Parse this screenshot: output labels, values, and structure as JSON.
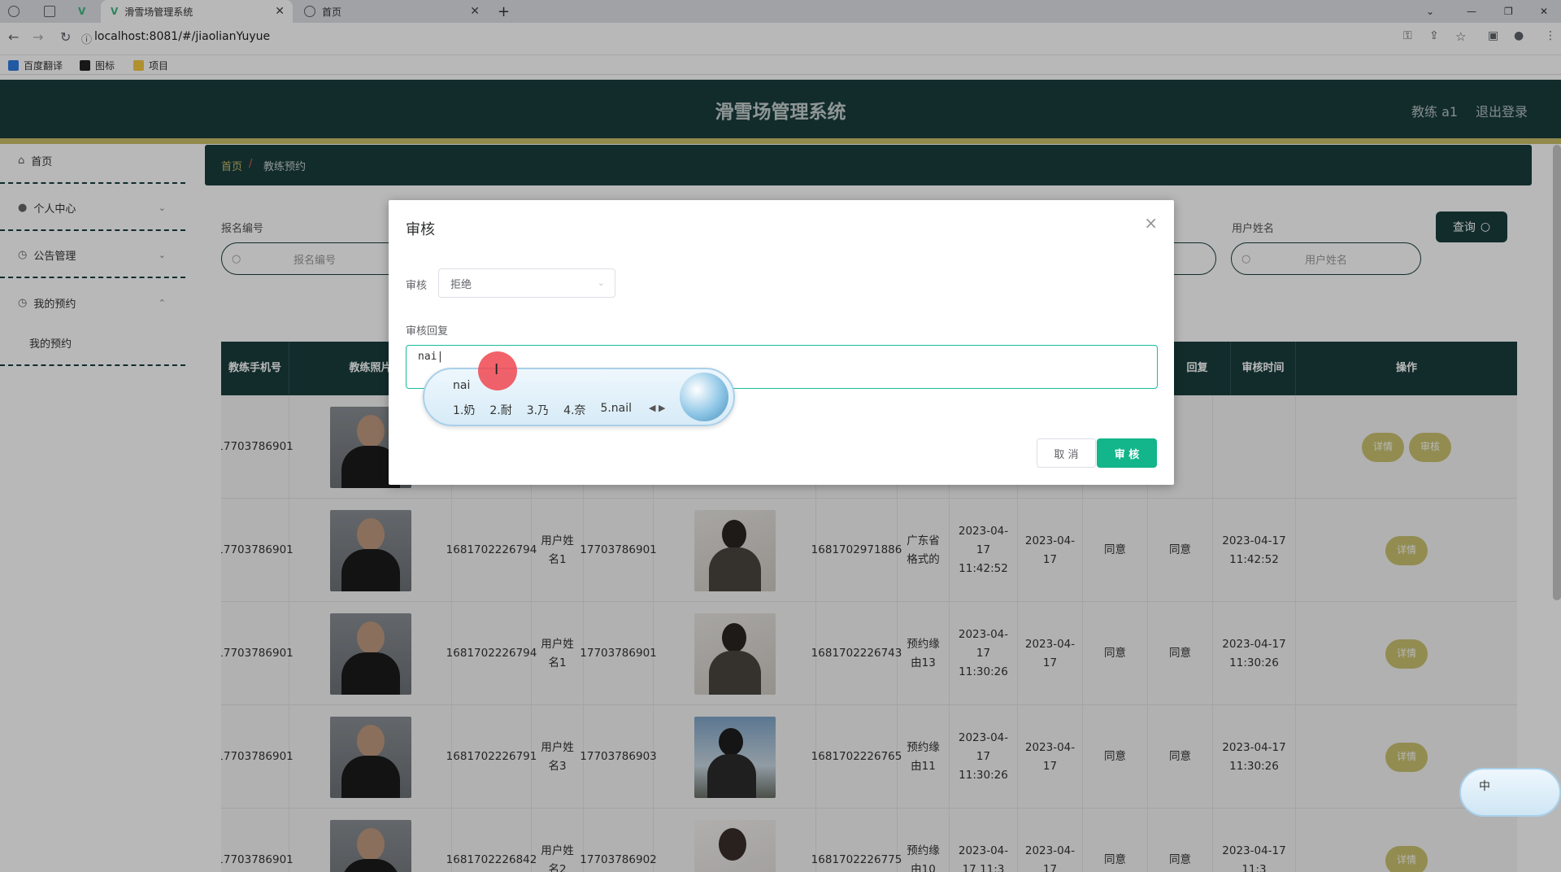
{
  "browser": {
    "tabs": [
      {
        "title": ""
      },
      {
        "title": ""
      },
      {
        "title": ""
      },
      {
        "title": "滑雪场管理系统"
      },
      {
        "title": "首页"
      }
    ],
    "url": "localhost:8081/#/jiaolianYuyue",
    "bookmarks": [
      "百度翻译",
      "图标",
      "项目"
    ]
  },
  "header": {
    "title": "滑雪场管理系统",
    "user": "教练 a1",
    "logout": "退出登录"
  },
  "sidebar": {
    "items": [
      {
        "label": "首页",
        "icon": "home-icon"
      },
      {
        "label": "个人中心",
        "icon": "user-icon"
      },
      {
        "label": "公告管理",
        "icon": "clock-icon"
      },
      {
        "label": "我的预约",
        "icon": "clock-icon"
      }
    ],
    "subitem": "我的预约"
  },
  "breadcrumb": {
    "home": "首页",
    "sep": "/",
    "current": "教练预约"
  },
  "search": {
    "label1": "报名编号",
    "placeholder1": "报名编号",
    "label2": "用户姓名",
    "placeholder2": "用户姓名",
    "query": "查询"
  },
  "table": {
    "headers": [
      "教练手机号",
      "教练照片",
      "",
      "",
      "",
      "",
      "",
      "",
      "",
      "",
      "",
      "回复",
      "审核时间",
      "操作"
    ],
    "rows": [
      {
        "phone": "17703786901",
        "num": "",
        "uname": "",
        "uphone": "",
        "regno": "",
        "reason": "",
        "t1": "",
        "d1": "",
        "s1": "",
        "s2": "",
        "t2": "",
        "actions": [
          "详情",
          "审核"
        ]
      },
      {
        "phone": "17703786901",
        "num": "1681702226794",
        "uname": "用户姓名1",
        "uphone": "17703786901",
        "regno": "1681702971886",
        "reason": "广东省格式的",
        "t1": "2023-04-17 11:42:52",
        "d1": "2023-04-17",
        "s1": "同意",
        "s2": "同意",
        "t2": "2023-04-17 11:42:52",
        "actions": [
          "详情"
        ]
      },
      {
        "phone": "17703786901",
        "num": "1681702226794",
        "uname": "用户姓名1",
        "uphone": "17703786901",
        "regno": "1681702226743",
        "reason": "预约缘由13",
        "t1": "2023-04-17 11:30:26",
        "d1": "2023-04-17",
        "s1": "同意",
        "s2": "同意",
        "t2": "2023-04-17 11:30:26",
        "actions": [
          "详情"
        ]
      },
      {
        "phone": "17703786901",
        "num": "1681702226791",
        "uname": "用户姓名3",
        "uphone": "17703786903",
        "regno": "1681702226765",
        "reason": "预约缘由11",
        "t1": "2023-04-17 11:30:26",
        "d1": "2023-04-17",
        "s1": "同意",
        "s2": "同意",
        "t2": "2023-04-17 11:30:26",
        "actions": [
          "详情"
        ]
      },
      {
        "phone": "17703786901",
        "num": "1681702226842",
        "uname": "用户姓名2",
        "uphone": "17703786902",
        "regno": "1681702226775",
        "reason": "预约缘由10",
        "t1": "2023-04-17 11:3",
        "d1": "2023-04-17",
        "s1": "同意",
        "s2": "同意",
        "t2": "2023-04-17 11:3",
        "actions": [
          "详情"
        ]
      }
    ]
  },
  "dialog": {
    "title": "审核",
    "audit_label": "审核",
    "audit_value": "拒绝",
    "reply_label": "审核回复",
    "reply_value": "nai",
    "cancel": "取 消",
    "ok": "审 核"
  },
  "ime": {
    "composition": "nai",
    "candidates": [
      "1.奶",
      "2.耐",
      "3.乃",
      "4.奈",
      "5.nail"
    ],
    "mini": "中"
  }
}
